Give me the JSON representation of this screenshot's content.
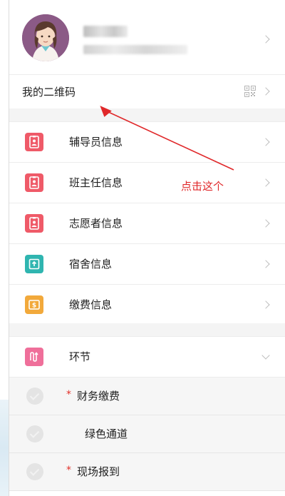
{
  "profile": {
    "avatar": "avatar-icon",
    "name": "",
    "info": ""
  },
  "qr": {
    "label": "我的二维码",
    "icon": "qr-code-icon"
  },
  "menu": {
    "items": [
      {
        "label": "辅导员信息",
        "icon": "badge-icon",
        "color": "#ef5a68"
      },
      {
        "label": "班主任信息",
        "icon": "badge-icon",
        "color": "#ef5a68"
      },
      {
        "label": "志愿者信息",
        "icon": "badge-icon",
        "color": "#ef5a68"
      },
      {
        "label": "宿舍信息",
        "icon": "dorm-icon",
        "color": "#2fb5b0"
      },
      {
        "label": "缴费信息",
        "icon": "payment-icon",
        "color": "#f2a93b"
      }
    ]
  },
  "steps": {
    "label": "环节",
    "icon": "steps-icon",
    "color": "#ef6f9a",
    "items": [
      {
        "label": "财务缴费",
        "required": "*"
      },
      {
        "label": "绿色通道",
        "required": ""
      },
      {
        "label": "现场报到",
        "required": "*"
      }
    ]
  },
  "annotation": {
    "text": "点击这个",
    "color": "#e0282a"
  }
}
